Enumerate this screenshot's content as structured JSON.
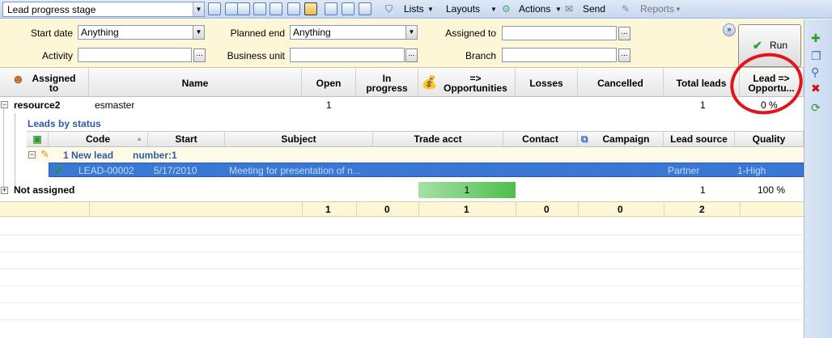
{
  "toolbar": {
    "view_select": "Lead progress stage",
    "menus": {
      "lists": "Lists",
      "layouts": "Layouts",
      "actions": "Actions",
      "send": "Send",
      "reports": "Reports"
    }
  },
  "filters": {
    "start_date_label": "Start date",
    "start_date_value": "Anything",
    "planned_end_label": "Planned end",
    "planned_end_value": "Anything",
    "assigned_to_label": "Assigned to",
    "assigned_to_value": "",
    "activity_label": "Activity",
    "activity_value": "",
    "business_unit_label": "Business unit",
    "business_unit_value": "",
    "branch_label": "Branch",
    "branch_value": "",
    "ellipsis": "...",
    "run_label": "Run"
  },
  "header": {
    "assigned_to": "Assigned to",
    "name": "Name",
    "open": "Open",
    "in_progress": "In progress",
    "opportunities": "=> Opportunities",
    "losses": "Losses",
    "cancelled": "Cancelled",
    "total_leads": "Total leads",
    "lead_opportu": "Lead => Opportu..."
  },
  "rows": {
    "resource2": {
      "assigned": "resource2",
      "name": "esmaster",
      "open": "1",
      "total": "1",
      "ratio": "0 %"
    },
    "leads_by_status": "Leads by status",
    "sub_header": {
      "code": "Code",
      "start": "Start",
      "subject": "Subject",
      "trade_acct": "Trade acct",
      "contact": "Contact",
      "campaign": "Campaign",
      "lead_source": "Lead source",
      "quality": "Quality"
    },
    "group": {
      "label": "1 New lead",
      "number": "number:1"
    },
    "lead": {
      "code": "LEAD-00002",
      "start": "5/17/2010",
      "subject": "Meeting for presentation of n...",
      "lead_source": "Partner",
      "quality": "1-High"
    },
    "not_assigned": {
      "assigned": "Not assigned",
      "opportunities": "1",
      "total": "1",
      "ratio": "100 %"
    }
  },
  "totals": {
    "open": "1",
    "in_progress": "0",
    "opportunities": "1",
    "losses": "0",
    "cancelled": "0",
    "total": "2"
  },
  "colors": {
    "accent": "#3a78d6",
    "filter_bg": "#fdf7d8",
    "annotation": "#e0141a",
    "progress": "#4cbf4c"
  },
  "icons": [
    "binoculars-icon",
    "person-icon",
    "money-bag-icon",
    "checkmark-icon",
    "plus-icon",
    "delete-icon",
    "refresh-icon"
  ]
}
